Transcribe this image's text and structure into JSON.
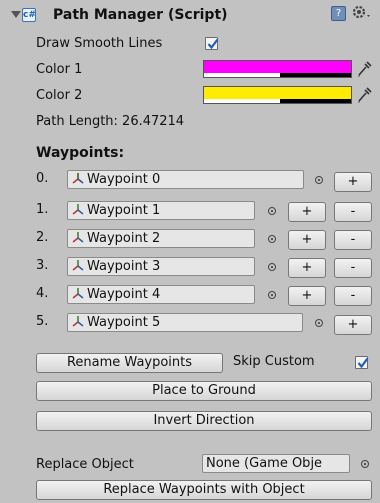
{
  "header": {
    "title": "Path Manager (Script)"
  },
  "draw_smooth": {
    "label": "Draw Smooth Lines",
    "checked": true
  },
  "color1": {
    "label": "Color 1",
    "color": "#ff00ff"
  },
  "color2": {
    "label": "Color 2",
    "color": "#ffea00"
  },
  "path_length": "Path Length: 26.47214",
  "waypoints_label": "Waypoints:",
  "waypoints": [
    {
      "index": "0.",
      "name": "Waypoint 0"
    },
    {
      "index": "1.",
      "name": "Waypoint 1"
    },
    {
      "index": "2.",
      "name": "Waypoint 2"
    },
    {
      "index": "3.",
      "name": "Waypoint 3"
    },
    {
      "index": "4.",
      "name": "Waypoint 4"
    },
    {
      "index": "5.",
      "name": "Waypoint 5"
    }
  ],
  "plus": "+",
  "minus": "-",
  "rename_button": "Rename Waypoints",
  "skip_custom": {
    "label": "Skip Custom",
    "checked": true
  },
  "place_ground_button": "Place to Ground",
  "invert_button": "Invert Direction",
  "replace_object": {
    "label": "Replace Object",
    "value": "None (Game Obje"
  },
  "replace_button": "Replace Waypoints with Object"
}
